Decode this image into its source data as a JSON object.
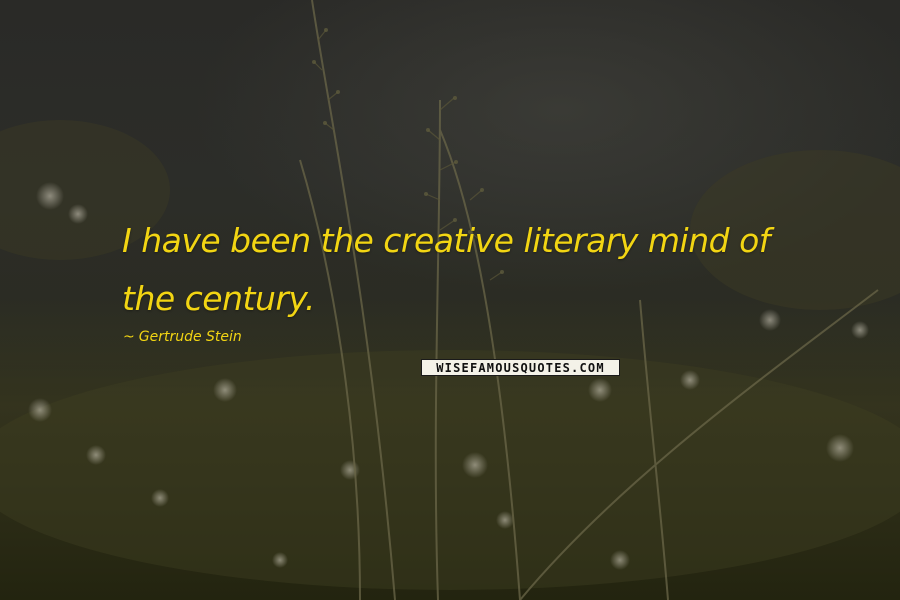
{
  "quote": {
    "text": "I have been the creative literary mind of the century."
  },
  "author": {
    "prefix_icon": "dash-icon",
    "name": "Gertrude Stein"
  },
  "watermark": {
    "text": "WISEFAMOUSQUOTES.COM"
  },
  "colors": {
    "quote_text": "#f2d513",
    "background": "#2a2b27",
    "grass": "#4d4a2a"
  }
}
